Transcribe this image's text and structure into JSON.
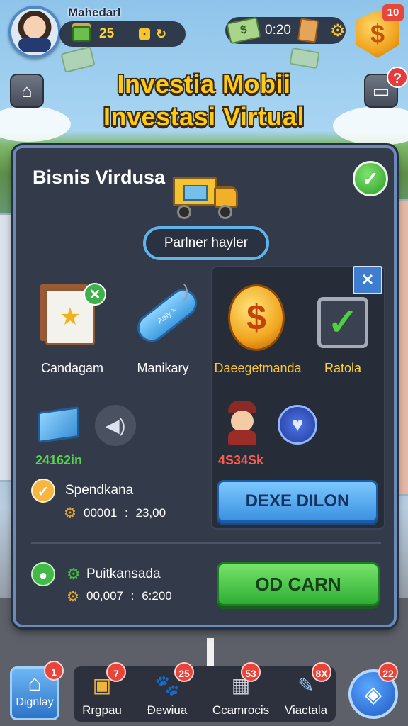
{
  "player": {
    "name": "Mahedarl",
    "cash": "25",
    "timer": "0:20",
    "coin_badge": "10"
  },
  "title": {
    "line1": "Investia Mobii",
    "line2": "Investasi Virtual"
  },
  "help_badge": "?",
  "panel": {
    "title": "Bisnis Virdusa",
    "partner_button": "Parlner hayler",
    "items": [
      {
        "label": "Candagam"
      },
      {
        "label": "Manikary"
      },
      {
        "label": "Daeegetmanda"
      },
      {
        "label": "Ratola"
      }
    ],
    "usb_text": "Aaiy ×",
    "green_value": "24162in",
    "red_value": "4S34Sk",
    "blue_button": "DEXE DILON",
    "status1": {
      "label": "Spendkana",
      "value_a": "00001",
      "sep": ":",
      "value_b": "23,00"
    },
    "status2": {
      "label": "Puitkansada",
      "value_a": "00,007",
      "sep": ":",
      "value_b": "6:200"
    },
    "green_button": "OD CARN"
  },
  "bottom_nav": {
    "home": {
      "label": "Dignlay",
      "badge": "1"
    },
    "items": [
      {
        "label": "Rrgpau",
        "badge": "7"
      },
      {
        "label": "Đewiua",
        "badge": "25"
      },
      {
        "label": "Ccamrocis",
        "badge": "53"
      },
      {
        "label": "Viactala",
        "badge": "8X"
      }
    ],
    "globe_badge": "22"
  },
  "colors": {
    "accent_gold": "#ffc917",
    "panel_bg": "#333a4a",
    "green_button": "#2fae34",
    "blue_button": "#3a92e0",
    "badge_red": "#e8443a"
  },
  "icons": [
    "avatar",
    "cash-stack-icon",
    "refresh-icon",
    "money-icon",
    "gear-icon",
    "dollar-coin-icon",
    "home-icon",
    "help-icon",
    "truck-icon",
    "check-icon",
    "certificate-icon",
    "usb-icon",
    "box-icon",
    "speaker-icon",
    "kid-icon",
    "heart-icon",
    "globe-icon"
  ]
}
